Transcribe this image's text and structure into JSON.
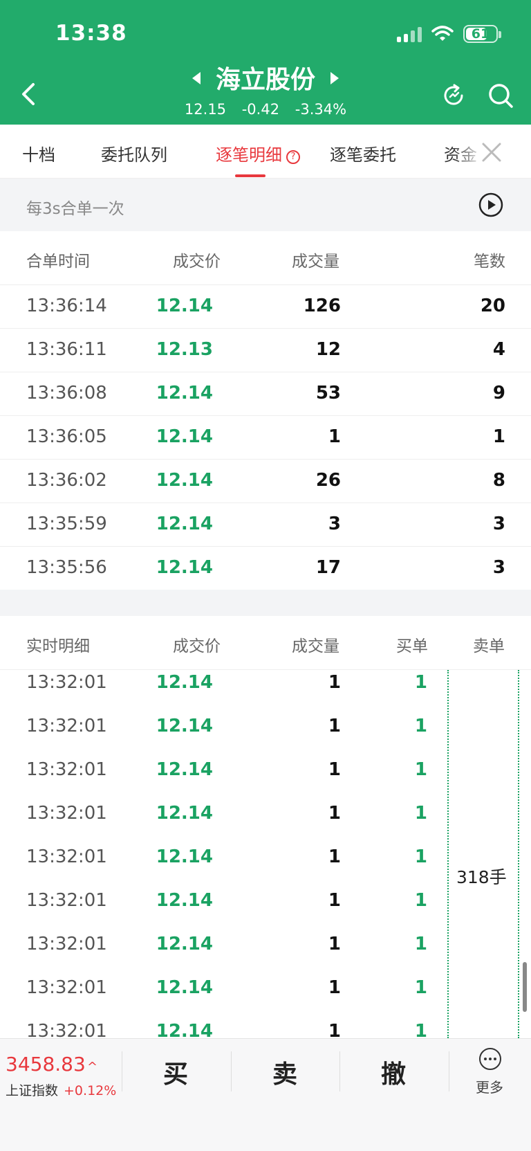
{
  "status": {
    "time": "13:38",
    "battery": "61"
  },
  "stock": {
    "name": "海立股份",
    "price": "12.15",
    "change": "-0.42",
    "change_pct": "-3.34%"
  },
  "tabs": [
    "十档",
    "委托队列",
    "逐笔明细",
    "逐笔委托",
    "资金"
  ],
  "active_tab": "逐笔明细",
  "merge": {
    "text": "每3s合单一次"
  },
  "merged": {
    "headers": [
      "合单时间",
      "成交价",
      "成交量",
      "笔数"
    ],
    "rows": [
      {
        "time": "13:36:14",
        "price": "12.14",
        "volume": "126",
        "count": "20"
      },
      {
        "time": "13:36:11",
        "price": "12.13",
        "volume": "12",
        "count": "4"
      },
      {
        "time": "13:36:08",
        "price": "12.14",
        "volume": "53",
        "count": "9"
      },
      {
        "time": "13:36:05",
        "price": "12.14",
        "volume": "1",
        "count": "1"
      },
      {
        "time": "13:36:02",
        "price": "12.14",
        "volume": "26",
        "count": "8"
      },
      {
        "time": "13:35:59",
        "price": "12.14",
        "volume": "3",
        "count": "3"
      },
      {
        "time": "13:35:56",
        "price": "12.14",
        "volume": "17",
        "count": "3"
      }
    ]
  },
  "realtime": {
    "headers": [
      "实时明细",
      "成交价",
      "成交量",
      "买单",
      "卖单"
    ],
    "sell_value": "318手",
    "rows": [
      {
        "time": "13:32:01",
        "price": "12.14",
        "volume": "1",
        "buy": "1"
      },
      {
        "time": "13:32:01",
        "price": "12.14",
        "volume": "1",
        "buy": "1"
      },
      {
        "time": "13:32:01",
        "price": "12.14",
        "volume": "1",
        "buy": "1"
      },
      {
        "time": "13:32:01",
        "price": "12.14",
        "volume": "1",
        "buy": "1"
      },
      {
        "time": "13:32:01",
        "price": "12.14",
        "volume": "1",
        "buy": "1"
      },
      {
        "time": "13:32:01",
        "price": "12.14",
        "volume": "1",
        "buy": "1"
      },
      {
        "time": "13:32:01",
        "price": "12.14",
        "volume": "1",
        "buy": "1"
      },
      {
        "time": "13:32:01",
        "price": "12.14",
        "volume": "1",
        "buy": "1"
      },
      {
        "time": "13:32:01",
        "price": "12.14",
        "volume": "1",
        "buy": "1"
      }
    ]
  },
  "bottom": {
    "index_value": "3458.83",
    "index_arrow": "^",
    "index_name": "上证指数",
    "index_change": "+0.12%",
    "buy": "买",
    "sell": "卖",
    "cancel": "撤",
    "more": "更多"
  },
  "colors": {
    "green": "#22ab6b",
    "price_green": "#1aa262",
    "red": "#e8383d"
  }
}
